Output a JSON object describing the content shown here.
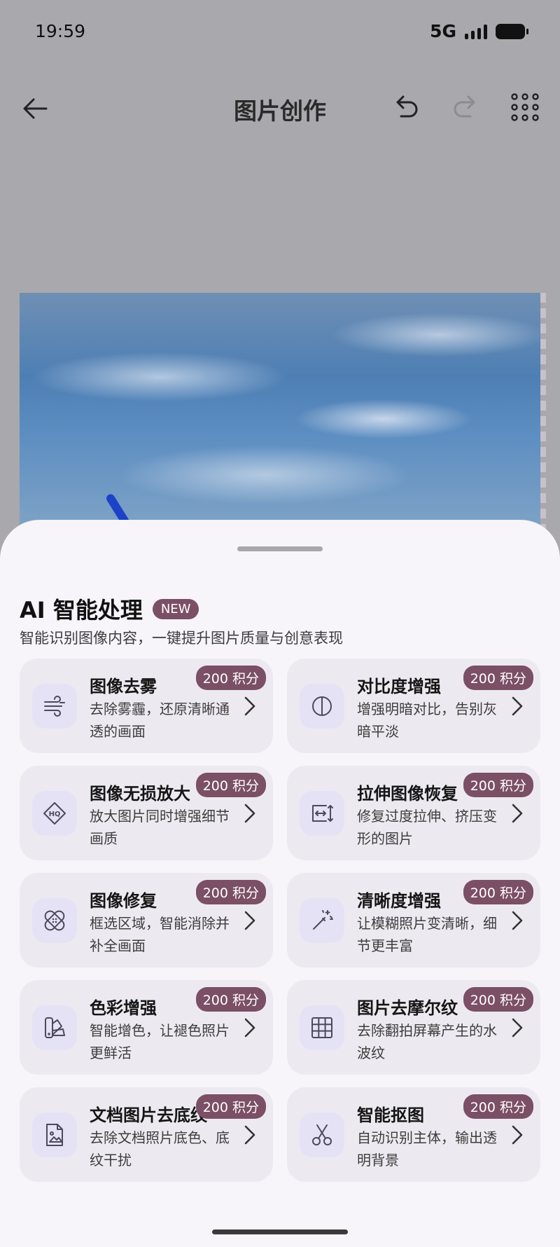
{
  "status_bar": {
    "time": "19:59",
    "network": "5G"
  },
  "app_bar": {
    "title": "图片创作"
  },
  "sheet": {
    "title": "AI 智能处理",
    "badge": "NEW",
    "subtitle": "智能识别图像内容，一键提升图片质量与创意表现",
    "cards": [
      {
        "title": "图像去雾",
        "desc": "去除雾霾，还原清晰通透的画面",
        "points": "200 积分",
        "icon": "defog-icon"
      },
      {
        "title": "对比度增强",
        "desc": "增强明暗对比，告别灰暗平淡",
        "points": "200 积分",
        "icon": "contrast-icon"
      },
      {
        "title": "图像无损放大",
        "desc": "放大图片同时增强细节画质",
        "points": "200 积分",
        "icon": "hq-upscale-icon"
      },
      {
        "title": "拉伸图像恢复",
        "desc": "修复过度拉伸、挤压变形的图片",
        "points": "200 积分",
        "icon": "stretch-icon"
      },
      {
        "title": "图像修复",
        "desc": "框选区域，智能消除并补全画面",
        "points": "200 积分",
        "icon": "bandage-icon"
      },
      {
        "title": "清晰度增强",
        "desc": "让模糊照片变清晰，细节更丰富",
        "points": "200 积分",
        "icon": "magic-wand-icon"
      },
      {
        "title": "色彩增强",
        "desc": "智能增色，让褪色照片更鲜活",
        "points": "200 积分",
        "icon": "color-palette-icon"
      },
      {
        "title": "图片去摩尔纹",
        "desc": "去除翻拍屏幕产生的水波纹",
        "points": "200 积分",
        "icon": "grid-icon"
      },
      {
        "title": "文档图片去底纹",
        "desc": "去除文档照片底色、底纹干扰",
        "points": "200 积分",
        "icon": "document-image-icon"
      },
      {
        "title": "智能抠图",
        "desc": "自动识别主体，输出透明背景",
        "points": "200 积分",
        "icon": "scissors-icon"
      }
    ]
  },
  "colors": {
    "badge": "#7b4f66",
    "sheet_bg": "#f7f4fa",
    "card_bg": "#eceaf0",
    "icon_bg": "#e6e2f6"
  }
}
